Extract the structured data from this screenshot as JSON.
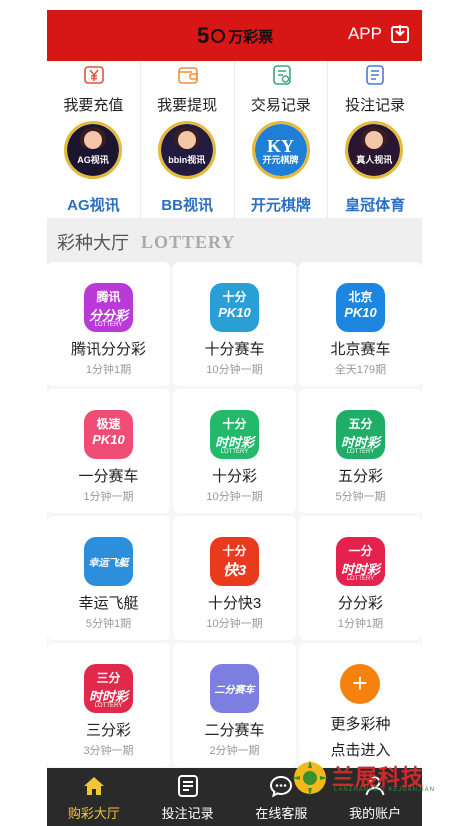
{
  "header": {
    "logo_digit": "5",
    "logo_text": "万彩票",
    "app_label": "APP",
    "bg_color": "#d71616"
  },
  "quick_actions": [
    {
      "label": "我要充值",
      "icon": "yen-recharge-icon",
      "color": "#e0533f"
    },
    {
      "label": "我要提现",
      "icon": "wallet-withdraw-icon",
      "color": "#ef8d3b"
    },
    {
      "label": "交易记录",
      "icon": "transaction-record-icon",
      "color": "#3ba77b"
    },
    {
      "label": "投注记录",
      "icon": "bet-record-icon",
      "color": "#4a7bd1"
    }
  ],
  "live_games": [
    {
      "name": "AG视讯",
      "badge": "AG视讯",
      "bg": "#1c1530"
    },
    {
      "name": "BB视讯",
      "badge": "bbin视讯",
      "bg": "#231a40"
    },
    {
      "name": "开元棋牌",
      "badge": "开元棋牌",
      "logo": "KY",
      "bg": "#1f7ed6"
    },
    {
      "name": "皇冠体育",
      "badge": "真人视讯",
      "bg": "#2a1630"
    }
  ],
  "lottery_section": {
    "title_cn": "彩种大厅",
    "title_en": "LOTTERY"
  },
  "games": [
    {
      "name": "腾讯分分彩",
      "sub": "1分钟1期",
      "icon_t1": "腾讯",
      "icon_t2": "分分彩",
      "icon_t3": "LOTTERY",
      "color": "#b93ad8"
    },
    {
      "name": "十分赛车",
      "sub": "10分钟一期",
      "icon_t1": "十分",
      "icon_t2": "PK10",
      "icon_t3": "",
      "color": "#2a9fd6"
    },
    {
      "name": "北京赛车",
      "sub": "全天179期",
      "icon_t1": "北京",
      "icon_t2": "PK10",
      "icon_t3": "",
      "color": "#1c86e0"
    },
    {
      "name": "一分赛车",
      "sub": "1分钟一期",
      "icon_t1": "极速",
      "icon_t2": "PK10",
      "icon_t3": "",
      "color": "#ef4d76"
    },
    {
      "name": "十分彩",
      "sub": "10分钟一期",
      "icon_t1": "十分",
      "icon_t2": "时时彩",
      "icon_t3": "LOTTERY",
      "color": "#22b96b"
    },
    {
      "name": "五分彩",
      "sub": "5分钟一期",
      "icon_t1": "五分",
      "icon_t2": "时时彩",
      "icon_t3": "LOTTERY",
      "color": "#1fad67"
    },
    {
      "name": "幸运飞艇",
      "sub": "5分钟1期",
      "icon_t1": "",
      "icon_t2": "幸运飞艇",
      "icon_t3": "",
      "color": "#2d8fdc"
    },
    {
      "name": "十分快3",
      "sub": "10分钟一期",
      "icon_t1": "十分",
      "icon_t2": "快3",
      "icon_t3": "",
      "color": "#ea3a1e"
    },
    {
      "name": "分分彩",
      "sub": "1分钟1期",
      "icon_t1": "一分",
      "icon_t2": "时时彩",
      "icon_t3": "LOTTERY",
      "color": "#e5214d"
    },
    {
      "name": "三分彩",
      "sub": "3分钟一期",
      "icon_t1": "三分",
      "icon_t2": "时时彩",
      "icon_t3": "LOTTERY",
      "color": "#e2284b"
    },
    {
      "name": "二分赛车",
      "sub": "2分钟一期",
      "icon_t1": "",
      "icon_t2": "二分赛车",
      "icon_t3": "",
      "color": "#7d7fe0"
    }
  ],
  "more_card": {
    "plus": "+",
    "line1": "更多彩种",
    "line2": "点击进入"
  },
  "tabbar": [
    {
      "label": "购彩大厅",
      "icon": "home-icon",
      "active": true
    },
    {
      "label": "投注记录",
      "icon": "bet-record-icon",
      "active": false
    },
    {
      "label": "在线客服",
      "icon": "chat-support-icon",
      "active": false
    },
    {
      "label": "我的账户",
      "icon": "account-icon",
      "active": false
    }
  ],
  "watermark": {
    "text": "兰展科技",
    "sub": "LANZHANKEJI KEJUANJIAN"
  }
}
